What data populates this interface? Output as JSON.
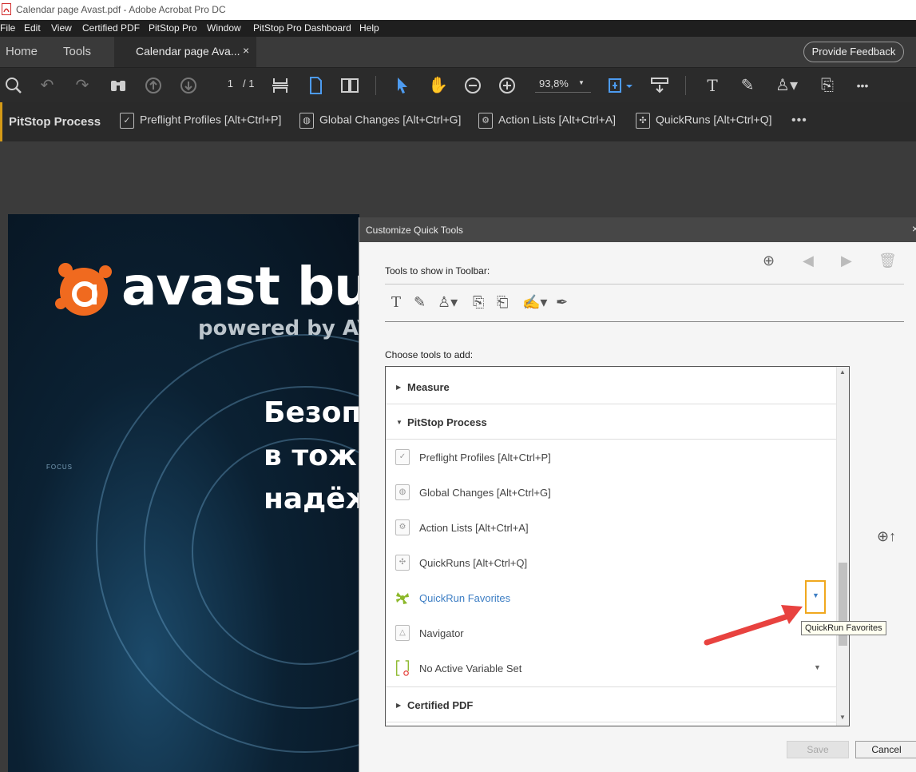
{
  "window": {
    "title": "Calendar page Avast.pdf - Adobe Acrobat Pro DC"
  },
  "menu": [
    "File",
    "Edit",
    "View",
    "Certified PDF",
    "PitStop Pro",
    "Window",
    "PitStop Pro Dashboard",
    "Help"
  ],
  "tabs": {
    "home": "Home",
    "tools": "Tools",
    "doc": "Calendar page Ava...",
    "close": "×"
  },
  "feedback": "Provide Feedback",
  "toolbar": {
    "page_current": "1",
    "page_total": "/  1",
    "zoom": "93,8%",
    "more": "•••"
  },
  "pitstop": {
    "title": "PitStop Process",
    "items": [
      "Preflight Profiles [Alt+Ctrl+P]",
      "Global Changes [Alt+Ctrl+G]",
      "Action Lists [Alt+Ctrl+A]",
      "QuickRuns [Alt+Ctrl+Q]"
    ],
    "more": "•••"
  },
  "document": {
    "brand": "avast bus",
    "powered": "powered by AV",
    "lines": [
      "Безоп",
      "в тож",
      "надёж"
    ],
    "focus": "FOCUS"
  },
  "dialog": {
    "title": "Customize Quick Tools",
    "close": "×",
    "tools_label": "Tools to show in Toolbar:",
    "choose_label": "Choose tools to add:",
    "groups": {
      "measure": "Measure",
      "pitstop": "PitStop Process",
      "certified": "Certified PDF"
    },
    "items": [
      "Preflight Profiles [Alt+Ctrl+P]",
      "Global Changes [Alt+Ctrl+G]",
      "Action Lists [Alt+Ctrl+A]",
      "QuickRuns [Alt+Ctrl+Q]",
      "QuickRun Favorites",
      "Navigator",
      "No Active Variable Set"
    ],
    "tooltip": "QuickRun Favorites",
    "save": "Save",
    "cancel": "Cancel"
  },
  "colors": {
    "accent_blue": "#3d7ec4",
    "highlight_orange": "#f0a81e",
    "arrow_red": "#e8423f",
    "pitstop_green": "#8cb82b"
  }
}
